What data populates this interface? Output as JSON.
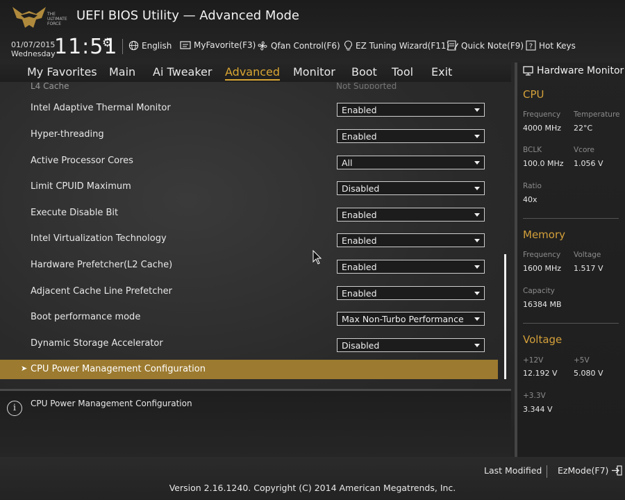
{
  "header": {
    "logo_text": "THE ULTIMATE FORCE",
    "title": "UEFI BIOS Utility — Advanced Mode",
    "date": "01/07/2015",
    "weekday": "Wednesday",
    "time": "11:51",
    "buttons": {
      "language": "English",
      "myfavorite": "MyFavorite(F3)",
      "qfan": "Qfan Control(F6)",
      "ez_tuning": "EZ Tuning Wizard(F11)",
      "quick_note": "Quick Note(F9)",
      "hot_keys": "Hot Keys"
    }
  },
  "tabs": [
    "My Favorites",
    "Main",
    "Ai Tweaker",
    "Advanced",
    "Monitor",
    "Boot",
    "Tool",
    "Exit"
  ],
  "active_tab": "Advanced",
  "accent_color": "#d9a633",
  "settings": {
    "l4_cache": {
      "label": "L4 Cache",
      "value": "Not Supported"
    },
    "rows": [
      {
        "label": "Intel Adaptive Thermal Monitor",
        "value": "Enabled"
      },
      {
        "label": "Hyper-threading",
        "value": "Enabled"
      },
      {
        "label": "Active Processor Cores",
        "value": "All"
      },
      {
        "label": "Limit CPUID Maximum",
        "value": "Disabled"
      },
      {
        "label": "Execute Disable Bit",
        "value": "Enabled"
      },
      {
        "label": "Intel Virtualization Technology",
        "value": "Enabled"
      },
      {
        "label": "Hardware Prefetcher(L2 Cache)",
        "value": "Enabled"
      },
      {
        "label": "Adjacent Cache Line Prefetcher",
        "value": "Enabled"
      },
      {
        "label": "Boot performance mode",
        "value": "Max Non-Turbo Performance"
      },
      {
        "label": "Dynamic Storage Accelerator",
        "value": "Disabled"
      }
    ],
    "submenu": {
      "arrow": "➤",
      "label": "CPU Power Management Configuration"
    }
  },
  "help": {
    "text": "CPU Power Management Configuration"
  },
  "hw_monitor": {
    "title": "Hardware Monitor",
    "cpu": {
      "heading": "CPU",
      "frequency_label": "Frequency",
      "frequency": "4000 MHz",
      "temperature_label": "Temperature",
      "temperature": "22°C",
      "bclk_label": "BCLK",
      "bclk": "100.0 MHz",
      "vcore_label": "Vcore",
      "vcore": "1.056 V",
      "ratio_label": "Ratio",
      "ratio": "40x"
    },
    "memory": {
      "heading": "Memory",
      "frequency_label": "Frequency",
      "frequency": "1600 MHz",
      "voltage_label": "Voltage",
      "voltage": "1.517 V",
      "capacity_label": "Capacity",
      "capacity": "16384 MB"
    },
    "voltage": {
      "heading": "Voltage",
      "v12_label": "+12V",
      "v12": "12.192 V",
      "v5_label": "+5V",
      "v5": "5.080 V",
      "v33_label": "+3.3V",
      "v33": "3.344 V"
    }
  },
  "footer": {
    "last_modified": "Last Modified",
    "ezmode": "EzMode(F7)",
    "version": "Version 2.16.1240. Copyright (C) 2014 American Megatrends, Inc."
  }
}
